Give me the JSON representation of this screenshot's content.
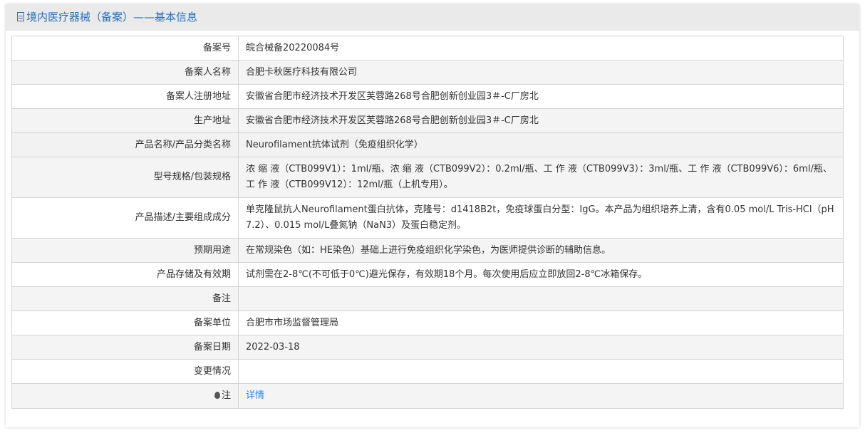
{
  "header": {
    "title": "境内医疗器械（备案）——基本信息"
  },
  "rows": [
    {
      "label": "备案号",
      "value": "皖合械备20220084号"
    },
    {
      "label": "备案人名称",
      "value": "合肥卡秋医疗科技有限公司"
    },
    {
      "label": "备案人注册地址",
      "value": "安徽省合肥市经济技术开发区芙蓉路268号合肥创新创业园3＃-C厂房北"
    },
    {
      "label": "生产地址",
      "value": "安徽省合肥市经济技术开发区芙蓉路268号合肥创新创业园3＃-C厂房北"
    },
    {
      "label": "产品名称/产品分类名称",
      "value": "Neurofilament抗体试剂（免疫组织化学）"
    },
    {
      "label": "型号规格/包装规格",
      "value": "浓 缩 液（CTB099V1）：1ml/瓶、浓 缩 液（CTB099V2）：0.2ml/瓶、工 作 液（CTB099V3）：3ml/瓶、工 作 液（CTB099V6）：6ml/瓶、工 作 液（CTB099V12）：12ml/瓶（上机专用）。"
    },
    {
      "label": "产品描述/主要组成成分",
      "value": "单克隆鼠抗人Neurofilament蛋白抗体，克隆号：d1418B2t，免疫球蛋白分型：IgG。本产品为组织培养上清，含有0.05 mol/L Tris-HCl（pH 7.2）、0.015 mol/L叠氮钠（NaN3）及蛋白稳定剂。"
    },
    {
      "label": "预期用途",
      "value": "在常规染色（如：HE染色）基础上进行免疫组织化学染色，为医师提供诊断的辅助信息。"
    },
    {
      "label": "产品存储及有效期",
      "value": "试剂需在2-8℃(不可低于0℃)避光保存，有效期18个月。每次使用后应立即放回2-8℃冰箱保存。"
    },
    {
      "label": "备注",
      "value": ""
    },
    {
      "label": "备案单位",
      "value": "合肥市市场监督管理局"
    },
    {
      "label": "备案日期",
      "value": "2022-03-18"
    },
    {
      "label": "变更情况",
      "value": ""
    }
  ],
  "note": {
    "label": "注",
    "link": "详情",
    "icon": "pin-icon"
  }
}
